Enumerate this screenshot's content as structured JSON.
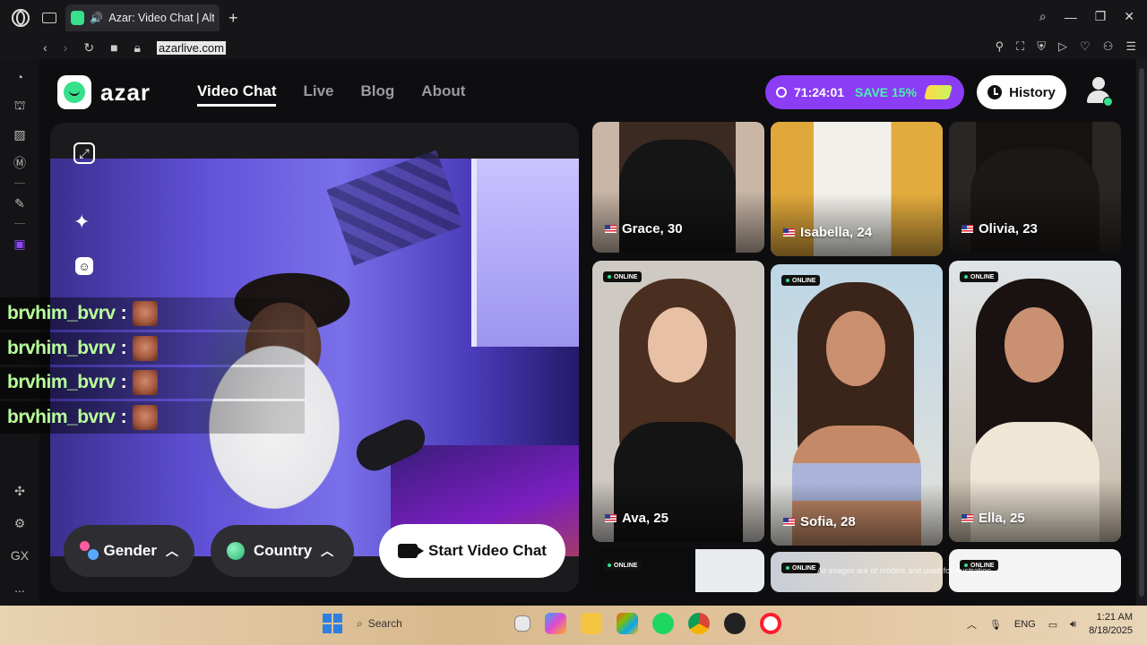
{
  "browser": {
    "tab_title": "Azar: Video Chat | Alte",
    "url": "azarlive.com",
    "new_tab": "+",
    "sidebar_label_gx": "GX",
    "sidebar_more": "..."
  },
  "nav": {
    "logo_text": "azar",
    "links": [
      "Video Chat",
      "Live",
      "Blog",
      "About"
    ],
    "active_link": "Video Chat"
  },
  "promo": {
    "timer": "71:24:01",
    "save_text": "SAVE 15%"
  },
  "history_button": "History",
  "controls": {
    "gender_label": "Gender",
    "country_label": "Country",
    "start_label": "Start Video Chat"
  },
  "chat_overlay": {
    "messages": [
      {
        "user": "brvhim_bvrv",
        "sep": ":"
      },
      {
        "user": "brvhim_bvrv",
        "sep": ":"
      },
      {
        "user": "brvhim_bvrv",
        "sep": ":"
      },
      {
        "user": "brvhim_bvrv",
        "sep": ":"
      }
    ]
  },
  "profiles": [
    {
      "label": "Grace, 30",
      "online_badge": ""
    },
    {
      "label": "Isabella, 24",
      "online_badge": ""
    },
    {
      "label": "Olivia, 23",
      "online_badge": ""
    },
    {
      "label": "Ava, 25",
      "online_badge": "ONLINE"
    },
    {
      "label": "Sofia, 28",
      "online_badge": "ONLINE"
    },
    {
      "label": "Ella, 25",
      "online_badge": "ONLINE"
    },
    {
      "label": "",
      "online_badge": "ONLINE"
    },
    {
      "label": "",
      "online_badge": "ONLINE"
    },
    {
      "label": "",
      "online_badge": "ONLINE"
    }
  ],
  "disclaimer": "All images are of models and used for illustration",
  "taskbar": {
    "search_placeholder": "Search",
    "language": "ENG",
    "time": "1:21 AM",
    "date": "8/18/2025"
  },
  "colors": {
    "brand_green": "#37e08b",
    "promo_purple": "#8b3cf5",
    "promo_save": "#4df0b0",
    "chat_username": "#b8ff9a"
  }
}
